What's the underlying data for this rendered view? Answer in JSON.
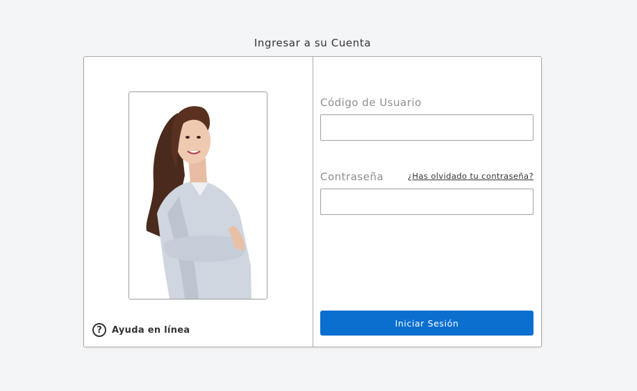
{
  "page": {
    "title": "Ingresar a su Cuenta"
  },
  "left_panel": {
    "photo": "woman-portrait",
    "help": {
      "icon": "question-circle-icon",
      "label": "Ayuda en línea"
    }
  },
  "login_form": {
    "username": {
      "label": "Código de Usuario",
      "value": "",
      "placeholder": ""
    },
    "password": {
      "label": "Contraseña",
      "value": "",
      "placeholder": ""
    },
    "forgot_link": "¿Has olvidado tu contraseña?",
    "submit_label": "Iniciar Sesión"
  },
  "colors": {
    "primary_button": "#0a6fcf",
    "label_gray": "#8d8d8d",
    "background": "#f4f5f7"
  }
}
